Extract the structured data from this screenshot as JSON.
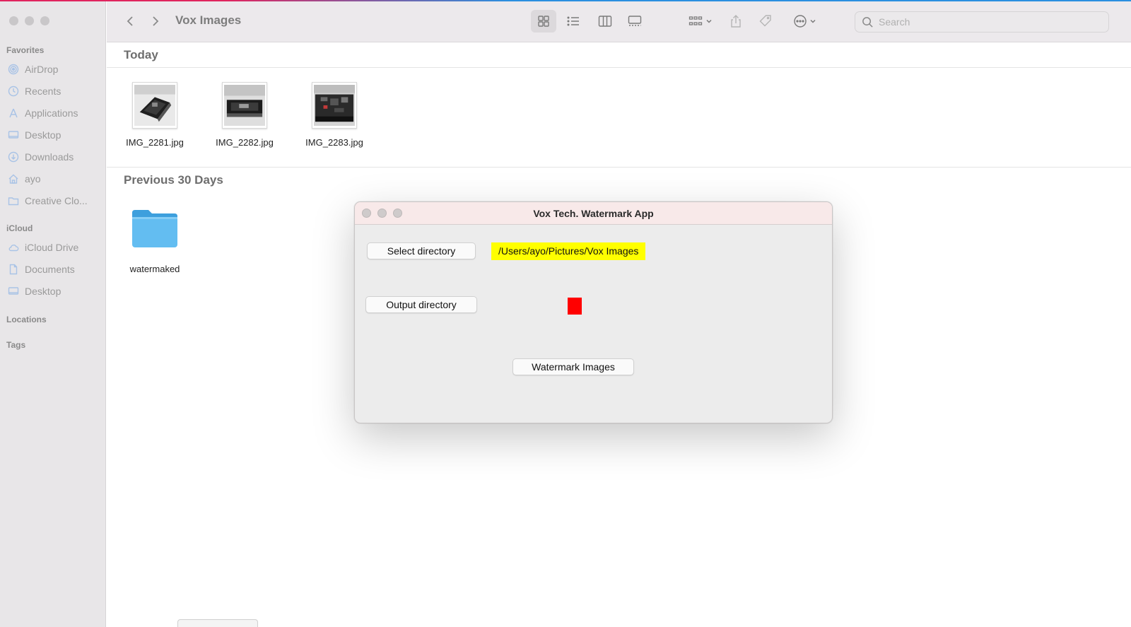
{
  "finder": {
    "window_title": "Vox Images",
    "sidebar": {
      "sections": [
        {
          "label": "Favorites"
        },
        {
          "label": "iCloud"
        },
        {
          "label": "Locations"
        },
        {
          "label": "Tags"
        }
      ],
      "favorites": [
        {
          "label": "AirDrop",
          "icon": "airdrop-icon"
        },
        {
          "label": "Recents",
          "icon": "clock-icon"
        },
        {
          "label": "Applications",
          "icon": "applications-icon"
        },
        {
          "label": "Desktop",
          "icon": "desktop-icon"
        },
        {
          "label": "Downloads",
          "icon": "download-icon"
        },
        {
          "label": "ayo",
          "icon": "home-icon"
        },
        {
          "label": "Creative Clo...",
          "icon": "folder-icon"
        }
      ],
      "icloud": [
        {
          "label": "iCloud Drive",
          "icon": "cloud-icon"
        },
        {
          "label": "Documents",
          "icon": "document-icon"
        },
        {
          "label": "Desktop",
          "icon": "desktop-icon"
        }
      ]
    },
    "toolbar": {
      "search_placeholder": "Search"
    },
    "groups": [
      {
        "title": "Today",
        "files": [
          {
            "name": "IMG_2281.jpg"
          },
          {
            "name": "IMG_2282.jpg"
          },
          {
            "name": "IMG_2283.jpg"
          }
        ]
      },
      {
        "title": "Previous 30 Days",
        "files": [
          {
            "name": "watermaked",
            "kind": "folder"
          }
        ]
      }
    ]
  },
  "dialog": {
    "title": "Vox Tech. Watermark App",
    "select_button": "Select directory",
    "selected_path": "/Users/ayo/Pictures/Vox Images",
    "output_button": "Output directory",
    "output_status_color": "#ff0000",
    "watermark_button": "Watermark Images",
    "path_highlight_color": "#ffff00"
  }
}
